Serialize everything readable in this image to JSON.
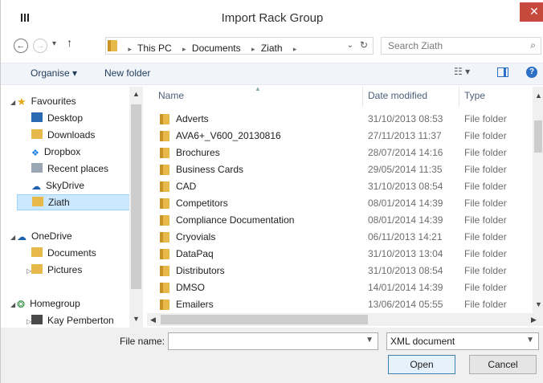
{
  "window": {
    "title": "Import Rack Group",
    "close_glyph": "✕"
  },
  "nav": {
    "back": "←",
    "forward": "→",
    "recent": "▾",
    "up": "↑"
  },
  "address": {
    "crumbs": [
      "This PC",
      "Documents",
      "Ziath"
    ],
    "separator": "▸",
    "dropdown": "⌄",
    "refresh": "↻"
  },
  "search": {
    "placeholder": "Search Ziath",
    "icon": "⌕"
  },
  "toolbar": {
    "organise": "Organise ▾",
    "new_folder": "New folder",
    "view_glyph": "☷ ▾",
    "help": "?"
  },
  "sidebar": {
    "favourites": {
      "label": "Favourites",
      "items": [
        "Desktop",
        "Downloads",
        "Dropbox",
        "Recent places",
        "SkyDrive",
        "Ziath"
      ]
    },
    "onedrive": {
      "label": "OneDrive",
      "items": [
        "Documents",
        "Pictures"
      ]
    },
    "homegroup": {
      "label": "Homegroup",
      "items": [
        "Kay Pemberton"
      ]
    }
  },
  "columns": {
    "name": "Name",
    "date": "Date modified",
    "type": "Type"
  },
  "files": [
    {
      "name": "Adverts",
      "date": "31/10/2013 08:53",
      "type": "File folder"
    },
    {
      "name": "AVA6+_V600_20130816",
      "date": "27/11/2013 11:37",
      "type": "File folder"
    },
    {
      "name": "Brochures",
      "date": "28/07/2014 14:16",
      "type": "File folder"
    },
    {
      "name": "Business Cards",
      "date": "29/05/2014 11:35",
      "type": "File folder"
    },
    {
      "name": "CAD",
      "date": "31/10/2013 08:54",
      "type": "File folder"
    },
    {
      "name": "Competitors",
      "date": "08/01/2014 14:39",
      "type": "File folder"
    },
    {
      "name": "Compliance Documentation",
      "date": "08/01/2014 14:39",
      "type": "File folder"
    },
    {
      "name": "Cryovials",
      "date": "06/11/2013 14:21",
      "type": "File folder"
    },
    {
      "name": "DataPaq",
      "date": "31/10/2013 13:04",
      "type": "File folder"
    },
    {
      "name": "Distributors",
      "date": "31/10/2013 08:54",
      "type": "File folder"
    },
    {
      "name": "DMSO",
      "date": "14/01/2014 14:39",
      "type": "File folder"
    },
    {
      "name": "Emailers",
      "date": "13/06/2014 05:55",
      "type": "File folder"
    }
  ],
  "bottom": {
    "filename_label": "File name:",
    "filename_value": "",
    "filetype": "XML document",
    "open": "Open",
    "cancel": "Cancel"
  }
}
